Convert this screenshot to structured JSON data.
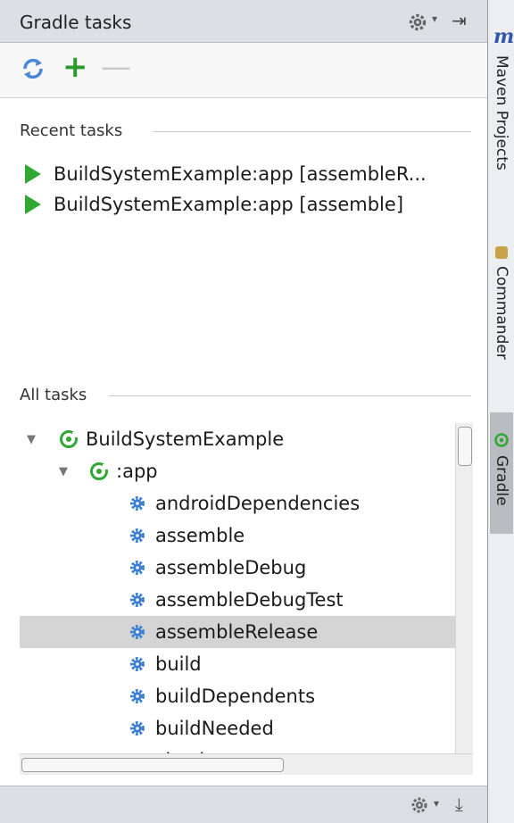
{
  "window": {
    "title": "Gradle tasks"
  },
  "colors": {
    "accent_green": "#2fa834",
    "gear_blue": "#3b7fd3",
    "selection": "#d4d4d4"
  },
  "icons": {
    "title_settings": "gear-icon",
    "title_hide": "hide-icon",
    "refresh": "refresh-icon",
    "add": "plus-icon",
    "remove": "minus-icon"
  },
  "toolbar": {
    "add_label": "+",
    "remove_label": "—"
  },
  "recent": {
    "label": "Recent tasks",
    "items": [
      "BuildSystemExample:app [assembleR...",
      "BuildSystemExample:app [assemble]"
    ]
  },
  "all": {
    "label": "All tasks",
    "root": "BuildSystemExample",
    "module": ":app",
    "tasks": [
      "androidDependencies",
      "assemble",
      "assembleDebug",
      "assembleDebugTest",
      "assembleRelease",
      "build",
      "buildDependents",
      "buildNeeded",
      "check"
    ],
    "selected": "assembleRelease"
  },
  "sidebar": {
    "tabs": [
      "Maven Projects",
      "Commander",
      "Gradle"
    ],
    "active": "Gradle",
    "maven_glyph": "m"
  }
}
